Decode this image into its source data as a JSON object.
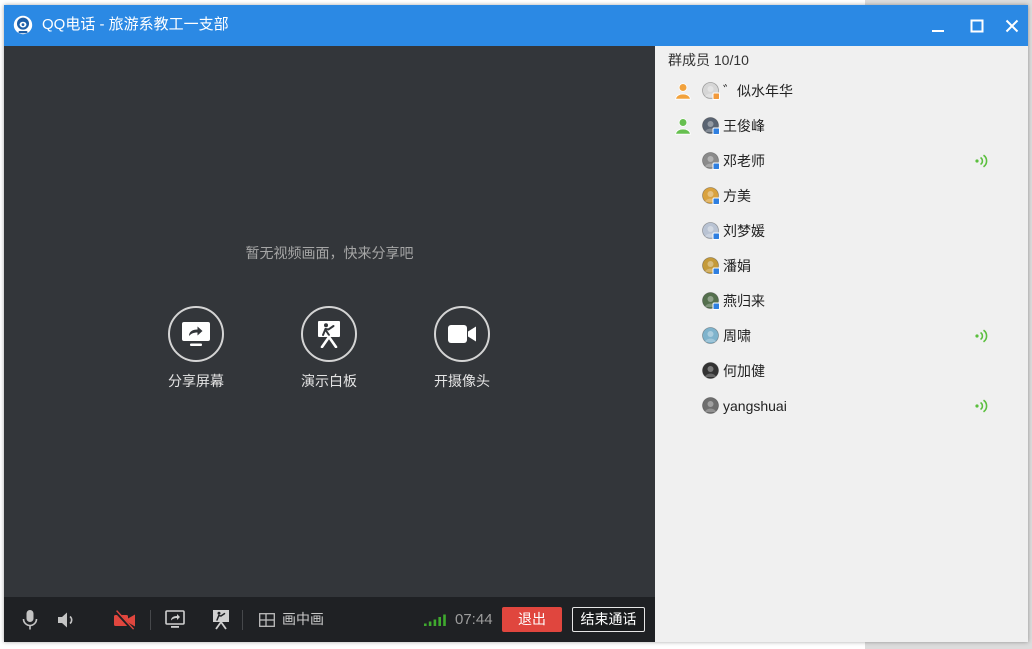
{
  "window": {
    "title": "QQ电话 - 旅游系教工一支部",
    "app_icon": "qq-call-icon",
    "controls": [
      "minimize-icon",
      "maximize-icon",
      "close-icon"
    ]
  },
  "video": {
    "empty_message": "暂无视频画面，快来分享吧",
    "actions": [
      {
        "label": "分享屏幕",
        "icon": "share-screen-icon"
      },
      {
        "label": "演示白板",
        "icon": "whiteboard-icon"
      },
      {
        "label": "开摄像头",
        "icon": "camera-icon"
      }
    ]
  },
  "toolbar": {
    "icons": [
      "microphone-icon",
      "speaker-icon",
      "camera-off-icon",
      "share-screen-icon",
      "whiteboard-icon",
      "picture-in-picture-icon",
      "signal-strength-icon"
    ],
    "pip_label": "画中画",
    "signal": {
      "level": 5,
      "max": 5
    },
    "timer": "07:44",
    "exit_label": "退出",
    "end_call_label": "结束通话"
  },
  "members": {
    "header": "群成员 10/10",
    "list": [
      {
        "name": "゛似水年华",
        "role_icon": "owner-icon",
        "avatar_color": "#d6d6d6",
        "badge_color": "#f29a3c",
        "speaking": false
      },
      {
        "name": "王俊峰",
        "role_icon": "admin-icon",
        "avatar_color": "#5a6472",
        "badge_color": "#2f7fe0",
        "speaking": false
      },
      {
        "name": "邓老师",
        "role_icon": null,
        "avatar_color": "#8b8b8b",
        "badge_color": "#2f7fe0",
        "speaking": true
      },
      {
        "name": "方美",
        "role_icon": null,
        "avatar_color": "#d9a23f",
        "badge_color": "#2f7fe0",
        "speaking": false
      },
      {
        "name": "刘梦媛",
        "role_icon": null,
        "avatar_color": "#b9c3d3",
        "badge_color": "#2f7fe0",
        "speaking": false
      },
      {
        "name": "潘娟",
        "role_icon": null,
        "avatar_color": "#c49a3a",
        "badge_color": "#2f7fe0",
        "speaking": false
      },
      {
        "name": "燕归来",
        "role_icon": null,
        "avatar_color": "#55704e",
        "badge_color": "#2f7fe0",
        "speaking": false
      },
      {
        "name": "周啸",
        "role_icon": null,
        "avatar_color": "#7fb3cc",
        "badge_color": null,
        "speaking": true
      },
      {
        "name": "何加健",
        "role_icon": null,
        "avatar_color": "#333333",
        "badge_color": null,
        "speaking": false
      },
      {
        "name": "yangshuai",
        "role_icon": null,
        "avatar_color": "#6e6e6e",
        "badge_color": null,
        "speaking": true
      }
    ]
  },
  "colors": {
    "title_bar": "#2b89e4",
    "video_bg": "#33363a",
    "toolbar_bg": "#1f2124",
    "panel_bg": "#f0f0f0",
    "exit_button": "#e0463e",
    "camera_off": "#e0463e",
    "speaking": "#5bbf3e",
    "signal": "#3faa2e",
    "owner": "#f2a23c",
    "admin": "#66bf4f"
  }
}
